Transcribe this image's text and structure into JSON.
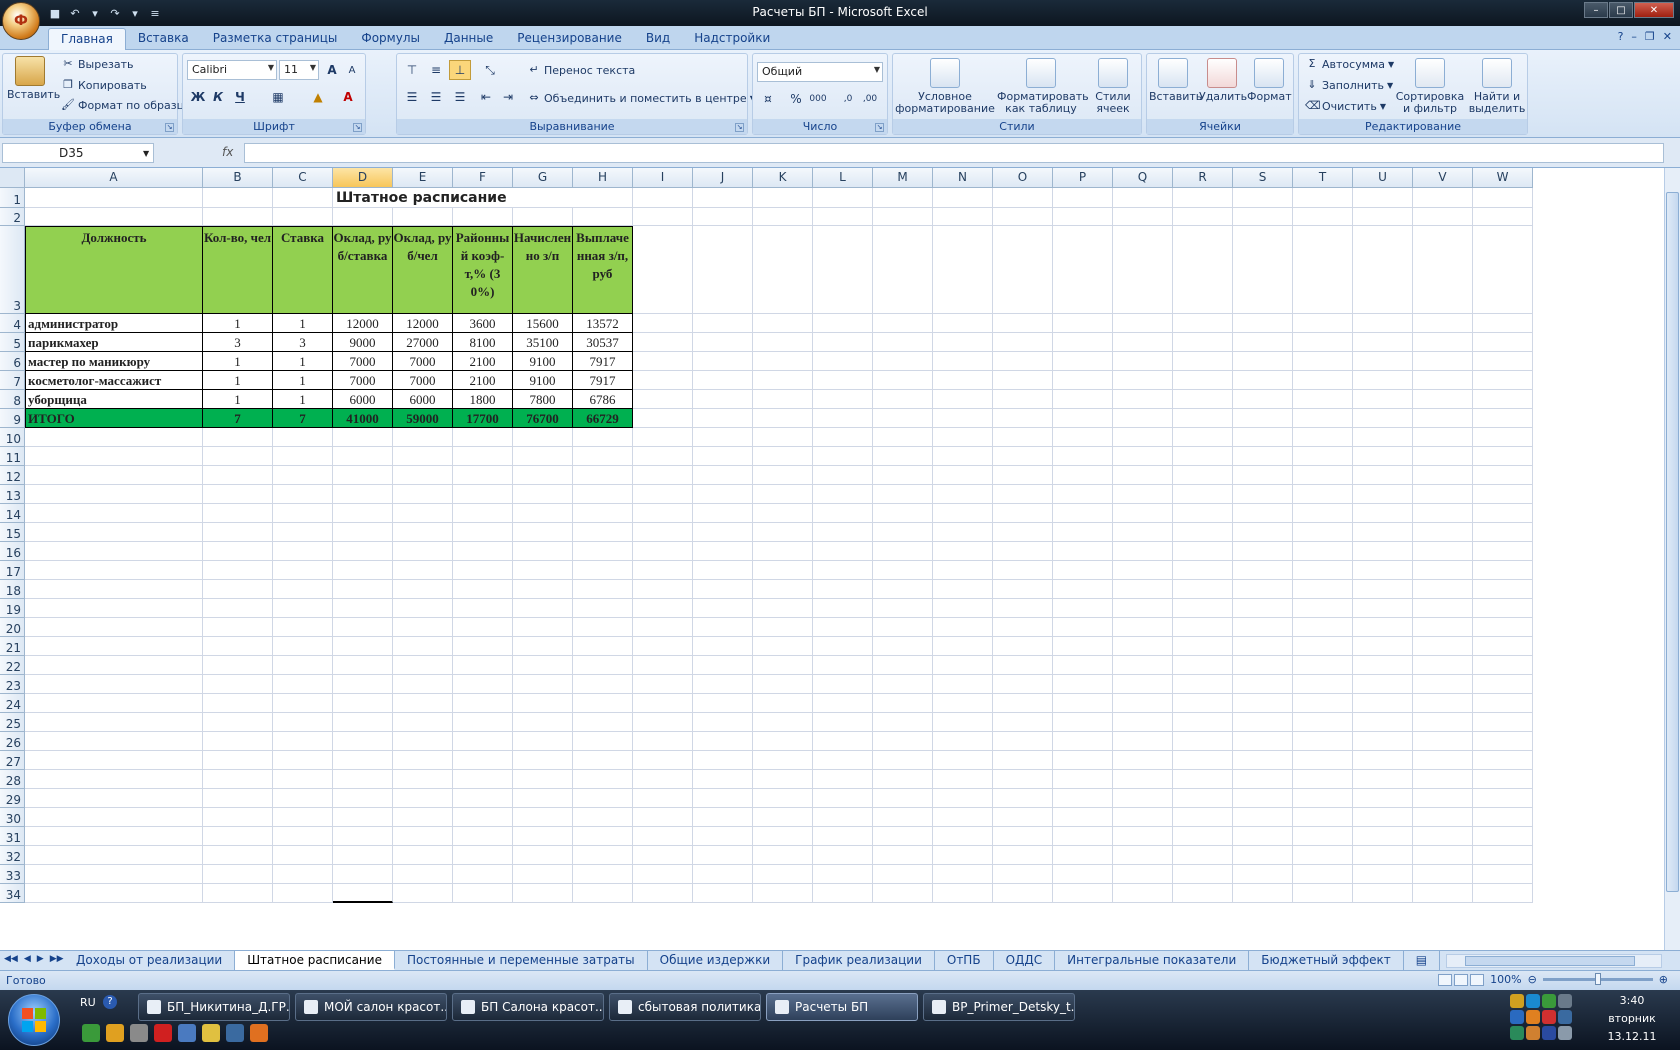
{
  "window": {
    "title": "Расчеты БП - Microsoft Excel",
    "office_button": "Ф"
  },
  "ribbon_tabs": [
    "Главная",
    "Вставка",
    "Разметка страницы",
    "Формулы",
    "Данные",
    "Рецензирование",
    "Вид",
    "Надстройки"
  ],
  "ribbon": {
    "clipboard": {
      "label": "Буфер обмена",
      "paste": "Вставить",
      "cut": "Вырезать",
      "copy": "Копировать",
      "format_painter": "Формат по образцу"
    },
    "font": {
      "label": "Шрифт",
      "name": "Calibri",
      "size": "11",
      "bold": "Ж",
      "italic": "К",
      "underline": "Ч",
      "grow": "A",
      "shrink": "A"
    },
    "alignment": {
      "label": "Выравнивание",
      "wrap": "Перенос текста",
      "merge": "Объединить и поместить в центре"
    },
    "number": {
      "label": "Число",
      "format": "Общий",
      "percent": "%",
      "thousands": "000",
      "inc_decimal": ",0",
      "dec_decimal": ",00"
    },
    "styles": {
      "label": "Стили",
      "conditional": [
        "Условное",
        "форматирование"
      ],
      "as_table": [
        "Форматировать",
        "как таблицу"
      ],
      "cell_styles": [
        "Стили",
        "ячеек"
      ]
    },
    "cells": {
      "label": "Ячейки",
      "insert": "Вставить",
      "delete": "Удалить",
      "format": "Формат"
    },
    "editing": {
      "label": "Редактирование",
      "autosum": "Автосумма",
      "fill": "Заполнить",
      "clear": "Очистить",
      "sort": [
        "Сортировка",
        "и фильтр"
      ],
      "find": [
        "Найти и",
        "выделить"
      ]
    }
  },
  "formula_bar": {
    "name_box": "D35",
    "fx": "fx",
    "formula": ""
  },
  "columns": [
    "A",
    "B",
    "C",
    "D",
    "E",
    "F",
    "G",
    "H",
    "I",
    "J",
    "K",
    "L",
    "M",
    "N",
    "O",
    "P",
    "Q",
    "R",
    "S",
    "T",
    "U",
    "V",
    "W"
  ],
  "selected_column": "D",
  "rows_count": 34,
  "sheet": {
    "title": "Штатное расписание",
    "headers": [
      "Должность",
      "Кол-во, чел",
      "Ставка",
      "Оклад, руб/ставка",
      "Оклад, руб/чел",
      "Районный коэф-т,% (30%)",
      "Начисленно з/п",
      "Выплаченная з/п, руб"
    ],
    "rows": [
      [
        "администратор",
        "1",
        "1",
        "12000",
        "12000",
        "3600",
        "15600",
        "13572"
      ],
      [
        "парикмахер",
        "3",
        "3",
        "9000",
        "27000",
        "8100",
        "35100",
        "30537"
      ],
      [
        "мастер по маникюру",
        "1",
        "1",
        "7000",
        "7000",
        "2100",
        "9100",
        "7917"
      ],
      [
        "косметолог-массажист",
        "1",
        "1",
        "7000",
        "7000",
        "2100",
        "9100",
        "7917"
      ],
      [
        "уборщица",
        "1",
        "1",
        "6000",
        "6000",
        "1800",
        "7800",
        "6786"
      ]
    ],
    "total": [
      "ИТОГО",
      "7",
      "7",
      "41000",
      "59000",
      "17700",
      "76700",
      "66729"
    ]
  },
  "sheet_tabs": [
    "Доходы от реализации",
    "Штатное расписание",
    "Постоянные и переменные затраты",
    "Общие издержки",
    "График реализации",
    "ОтПБ",
    "ОДДС",
    "Интегральные показатели",
    "Бюджетный эффект"
  ],
  "active_sheet": "Штатное расписание",
  "status": {
    "text": "Готово",
    "zoom": "100%"
  },
  "taskbar": {
    "lang": "RU",
    "tasks": [
      "БП_Никитина_Д.ГР....",
      "МОЙ салон красот...",
      "БП Салона красот...",
      "сбытовая политика...",
      "Расчеты БП",
      "BP_Primer_Detsky_t..."
    ],
    "active_task": "Расчеты БП",
    "time": "3:40",
    "day": "вторник",
    "date": "13.12.11"
  },
  "colors": {
    "header_green": "#92d050",
    "total_green": "#00b050",
    "ribbon_blue": "#15428b"
  }
}
